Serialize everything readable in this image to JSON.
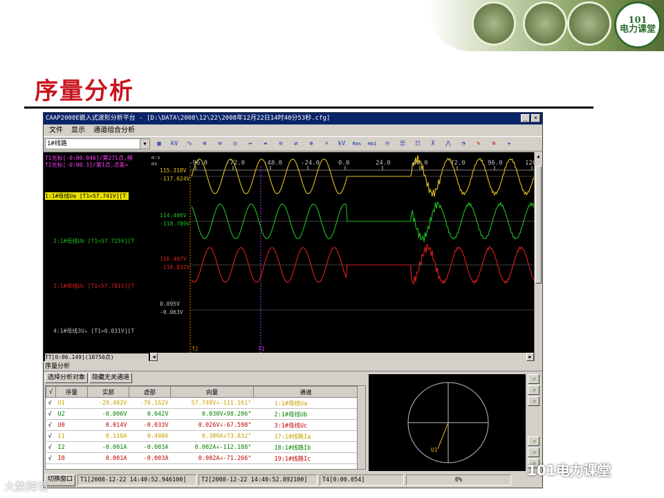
{
  "slide": {
    "title": "序量分析",
    "logo_text": [
      "101",
      "电力课堂"
    ],
    "watermark_left": "大数跨境",
    "watermark_right": "101电力课堂"
  },
  "window": {
    "title": "CAAP2008E嵌入式波形分析平台 - [D:\\DATA\\2008\\12\\22\\2008年12月22日14时40分53秒.cfg]",
    "menu": [
      "文件",
      "显示",
      "通道组合分析"
    ],
    "combo_value": "1#线路",
    "toolbar_icons": [
      "grid-icon",
      "kv-icon",
      "wave-icon",
      "zoom-in-icon",
      "zoom-out-icon",
      "zoom-icon",
      "expand-h-icon",
      "shrink-h-icon",
      "zoom-v-icon",
      "swap-icon",
      "zoom-fit-icon",
      "search-icon",
      "kv-unit-icon",
      "rms-icon",
      "harmonic-icon",
      "clock-icon",
      "list-icon",
      "list2-icon",
      "filter-icon",
      "spectrum-icon",
      "gauge-icon",
      "pen-icon",
      "wave2-icon",
      "settings-icon"
    ],
    "toolbar_labels": {
      "kv": "kV",
      "kv2": "kV",
      "rms": "Rms",
      "hm": "Hm1"
    }
  },
  "scope": {
    "cursor1": "T1光标[-0:00.046]/第271点,频",
    "cursor2": "T2光标[-0:00.1]/第1点,点差=",
    "axis_units_top": "m:s",
    "axis_units_bottom": "ms",
    "ticks": [
      "-96.0",
      "-72.0",
      "-48.0",
      "-24.0",
      "0.0",
      "24.0",
      "48.0",
      "72.0",
      "96.0",
      "120"
    ],
    "channels": [
      {
        "label": "1:1#母线Ua [T1=57.741V][T",
        "color": "#e8c020",
        "max": "115.318V",
        "min": "-117.624V"
      },
      {
        "label": "2:1#母线Ub [T1=57.725V][T",
        "color": "#20c020",
        "max": "114.406V",
        "min": "-118.789V"
      },
      {
        "label": "3:1#母线Uc [T1=57.781V][T",
        "color": "#e02020",
        "max": "116.407V",
        "min": "-118.832V"
      },
      {
        "label": "4:1#母线3U₀ [T1=0.031V][T",
        "color": "#c0c0c0",
        "max": "0.095V",
        "min": "-0.063V"
      }
    ],
    "t2_label": "T2",
    "t1_label": "T1",
    "tt_info": "TT[0:06.149](18750点)"
  },
  "analysis": {
    "panel_title": "序量分析",
    "btn_select": "选择分析对象",
    "btn_hide": "隐藏无关通道",
    "columns": [
      "√",
      "序量",
      "实部",
      "虚部",
      "向量",
      "通道"
    ],
    "rows": [
      {
        "check": "√",
        "name": "U1",
        "re": "-29.482V",
        "im": "-76.162V",
        "vec": "57.749V∠-111.161°",
        "ch": "1:1#母线Ua",
        "color": "#c8a000"
      },
      {
        "check": "√",
        "name": "U2",
        "re": "-0.006V",
        "im": "0.042V",
        "vec": "0.030V∠98.206°",
        "ch": "2:1#母线Ub",
        "color": "#008000"
      },
      {
        "check": "√",
        "name": "U0",
        "re": "0.014V",
        "im": "-0.033V",
        "vec": "0.026V∠-67.598°",
        "ch": "3:1#母线Uc",
        "color": "#c00000"
      },
      {
        "check": "√",
        "name": "I1",
        "re": "0.118A",
        "im": "0.408A",
        "vec": "0.300A∠73.832°",
        "ch": "17:1#线路Ia",
        "color": "#c8a000"
      },
      {
        "check": "√",
        "name": "I2",
        "re": "-0.001A",
        "im": "-0.003A",
        "vec": "0.002A∠-112.188°",
        "ch": "18:1#线路Ib",
        "color": "#008000"
      },
      {
        "check": "√",
        "name": "I0",
        "re": "0.001A",
        "im": "-0.003A",
        "vec": "0.002A∠-71.266°",
        "ch": "19:1#线路Ic",
        "color": "#c00000"
      }
    ],
    "phasor_label": "U1"
  },
  "status": {
    "switch_btn": "切换窗口",
    "t1": "T1[2008-12-22 14:40:52.946100]",
    "t2": "T2[2008-12-22 14:40:52.892100]",
    "t4": "T4[0:00.054]",
    "progress": "0%"
  }
}
